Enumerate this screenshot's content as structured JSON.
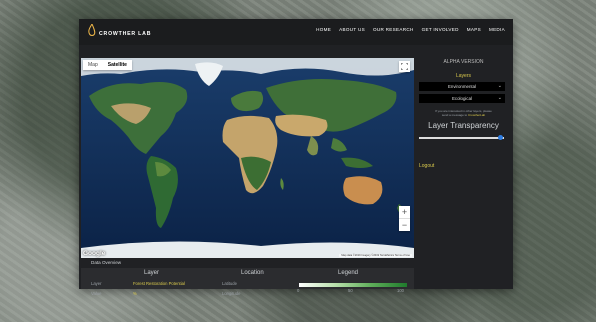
{
  "brand": {
    "name": "CROWTHER LAB",
    "flame_color": "#f0b84a"
  },
  "nav": [
    "HOME",
    "ABOUT US",
    "OUR RESEARCH",
    "GET INVOLVED",
    "MAPS",
    "MEDIA"
  ],
  "map": {
    "type_options": [
      "Map",
      "Satellite"
    ],
    "selected_type": "Satellite",
    "google_label": "Google",
    "attribution": "Map data ©2019 Imagery ©2019 TerraMetrics  Terms of Use",
    "zoom_in": "+",
    "zoom_out": "−"
  },
  "data_overview": {
    "title": "Data Overview",
    "layer_heading": "Layer",
    "location_heading": "Location",
    "legend_heading": "Legend",
    "layer_label": "Layer",
    "layer_value": "Forest Restoration Potential",
    "value_label": "Value",
    "value_value": "%",
    "latitude_label": "Latitude",
    "longitude_label": "Longitude",
    "legend_ticks": [
      "0",
      "50",
      "100"
    ]
  },
  "sidebar": {
    "version": "ALPHA VERSION",
    "layers_label": "Layers",
    "select_1": "Environmental",
    "select_2": "Ecological",
    "note_line1": "If you are interested in other layers, please",
    "note_line2": "send a message to ",
    "note_link": "CrowtherLab",
    "transparency_label": "Layer Transparency",
    "transparency_value": 1.0,
    "logout": "Logout"
  },
  "colors": {
    "accent": "#d8c84c",
    "slider_knob": "#2f7de1",
    "ocean": "#0f2d55"
  }
}
